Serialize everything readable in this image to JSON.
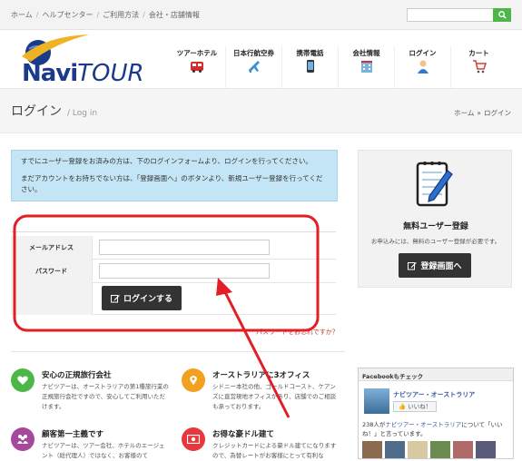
{
  "topbar": {
    "breadcrumbs": [
      "ホーム",
      "ヘルプセンター",
      "ご利用方法",
      "会社・店舗情報"
    ],
    "separator": "/",
    "search_placeholder": "",
    "search_icon": "search-icon"
  },
  "logo": {
    "text_main": "Navi",
    "text_sub": "TOUR"
  },
  "nav": [
    {
      "label": "ツアーホテル",
      "icon": "bus-icon"
    },
    {
      "label": "日本行航空券",
      "icon": "airplane-icon"
    },
    {
      "label": "携帯電話",
      "icon": "mobile-phone-icon"
    },
    {
      "label": "会社情報",
      "icon": "building-icon"
    },
    {
      "label": "ログイン",
      "icon": "user-icon"
    },
    {
      "label": "カート",
      "icon": "cart-icon"
    }
  ],
  "page": {
    "title": "ログイン",
    "subtitle": "/ Log in",
    "breadcrumb_home": "ホーム",
    "breadcrumb_arrow": "»",
    "breadcrumb_current": "ログイン"
  },
  "info": {
    "line1": "すでにユーザー登録をお済みの方は、下のログインフォームより、ログインを行ってください。",
    "line2": "まだアカウントをお持ちでない方は、「登録画面へ」のボタンより、新規ユーザー登録を行ってください。"
  },
  "form": {
    "email_label": "メールアドレス",
    "email_value": "",
    "password_label": "パスワード",
    "password_value": "",
    "login_button": "ログインする",
    "forgot_link": "パスワードをお忘れですか？"
  },
  "sidebar": {
    "title": "無料ユーザー登録",
    "desc": "お申込みには、無料のユーザー登録が必要です。",
    "register_button": "登録画面へ"
  },
  "features": [
    {
      "title": "安心の正規旅行会社",
      "text": "ナビツアーは、オーストラリアの第1種旅行業の正規旅行会社ですので、安心してご利用いただけます。",
      "icon": "heart-icon",
      "color": "#4cb748"
    },
    {
      "title": "オーストラリアに3オフィス",
      "text": "シドニー本社の他、ゴールドコースト、ケアンズに直営現地オフィスがあり、店舗でのご相談も承っております。",
      "icon": "location-pin-icon",
      "color": "#f1a11d"
    },
    {
      "title": "顧客第一主義です",
      "text": "ナビツアーは、ツアー会社、ホテルのエージェント（総代理人）ではなく、お客様のて",
      "icon": "group-icon",
      "color": "#a6489b"
    },
    {
      "title": "お得な豪ドル建て",
      "text": "クレジットカードによる豪ドル建てになりますので、為替レートがお客様にとって有利な",
      "icon": "money-icon",
      "color": "#e8383d"
    }
  ],
  "facebook": {
    "header": "Facebookもチェック",
    "page_name": "ナビツアー・オーストラリア",
    "like_button": "いいね！",
    "count_prefix": "238人が",
    "count_link": "ナビツアー・オーストラリア",
    "count_suffix": "について「いいね！」と言っています。"
  },
  "colors": {
    "accent_green": "#4cb748",
    "annotation_red": "#e21f26",
    "info_bg": "#c4e5f5",
    "dark_button": "#333333"
  }
}
